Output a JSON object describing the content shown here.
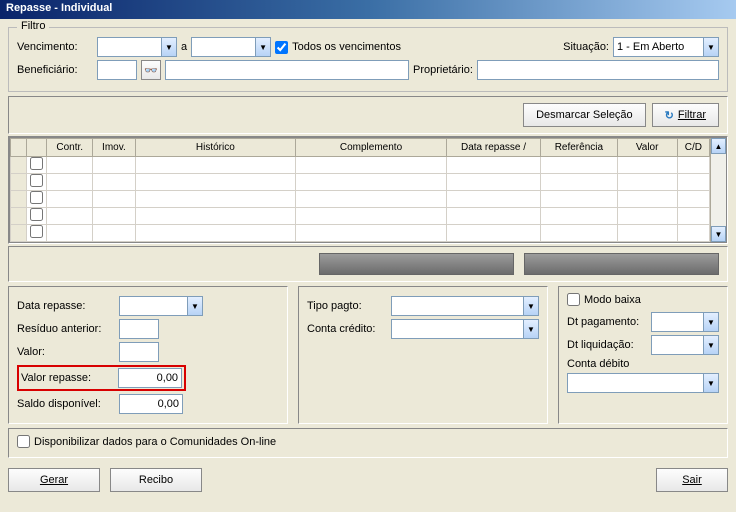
{
  "window": {
    "title": "Repasse - Individual"
  },
  "filtro": {
    "legend": "Filtro",
    "vencimento_label": "Vencimento:",
    "a": "a",
    "todos_venc": "Todos os vencimentos",
    "situacao_label": "Situação:",
    "situacao_value": "1 - Em Aberto",
    "beneficiario_label": "Beneficiário:",
    "proprietario_label": "Proprietário:"
  },
  "actions": {
    "desmarcar": "Desmarcar Seleção",
    "filtrar": "Filtrar"
  },
  "table": {
    "cols": [
      "",
      "",
      "Contr.",
      "Imov.",
      "Histórico",
      "Complemento",
      "Data repasse   /",
      "Referência",
      "Valor",
      "C/D"
    ]
  },
  "left": {
    "data_repasse": "Data repasse:",
    "residuo": "Resíduo anterior:",
    "valor": "Valor:",
    "valor_repasse": "Valor repasse:",
    "valor_repasse_value": "0,00",
    "saldo": "Saldo disponível:",
    "saldo_value": "0,00"
  },
  "mid": {
    "tipo_pagto": "Tipo pagto:",
    "conta_credito": "Conta crédito:"
  },
  "right": {
    "modo_baixa": "Modo baixa",
    "dt_pagamento": "Dt pagamento:",
    "dt_liquidacao": "Dt liquidação:",
    "conta_debito": "Conta débito"
  },
  "extra": {
    "disponibilizar": "Disponibilizar dados para o Comunidades On-line"
  },
  "buttons": {
    "gerar": "Gerar",
    "recibo": "Recibo",
    "sair": "Sair"
  }
}
